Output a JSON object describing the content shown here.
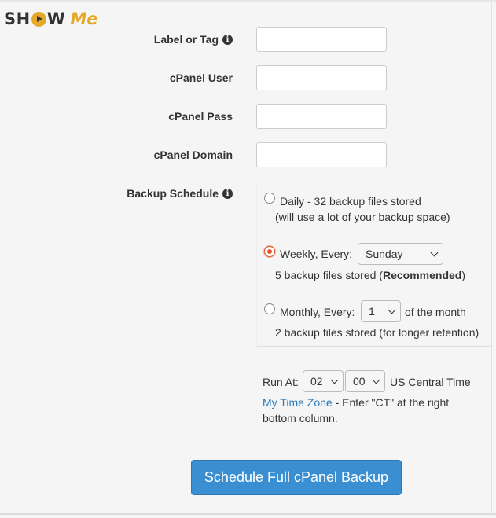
{
  "logo": {
    "show": "SHOW",
    "me": "Me"
  },
  "fields": {
    "label_tag": {
      "label": "Label or Tag",
      "value": "",
      "info_icon": "info-circle-icon"
    },
    "cpanel_user": {
      "label": "cPanel User",
      "value": ""
    },
    "cpanel_pass": {
      "label": "cPanel Pass",
      "value": ""
    },
    "cpanel_domain": {
      "label": "cPanel Domain",
      "value": ""
    }
  },
  "schedule": {
    "label": "Backup Schedule",
    "daily": {
      "line1": "Daily - 32 backup files stored",
      "line2": "(will use a lot of your backup space)",
      "checked": false
    },
    "weekly": {
      "prefix": "Weekly, Every:",
      "day": "Sunday",
      "line2_prefix": "5 backup files stored (",
      "line2_bold": "Recommended",
      "line2_suffix": ")",
      "checked": true
    },
    "monthly": {
      "prefix": "Monthly, Every:",
      "day": "1",
      "suffix": "of the month",
      "line2": "2 backup files stored (for longer retention)",
      "checked": false
    }
  },
  "run_at": {
    "label": "Run At:",
    "hour": "02",
    "minute": "00",
    "timezone": "US Central Time",
    "link": "My Time Zone",
    "note1": " - Enter \"CT\" at the right",
    "note2": "bottom column."
  },
  "submit": {
    "label": "Schedule Full cPanel Backup"
  },
  "colors": {
    "accent": "#3a8fd3",
    "radio_checked": "#e0572a",
    "logo_gold": "#e4a928",
    "link": "#2a7ab8"
  }
}
